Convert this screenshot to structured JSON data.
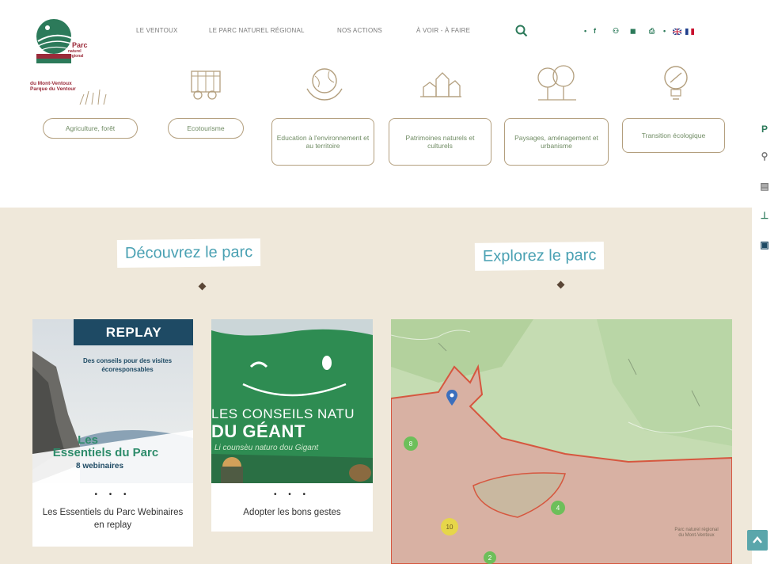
{
  "logo": {
    "brand_big": "Parc",
    "brand_small": "naturel régional",
    "brand_bottom": "du Mont-Ventoux Parque du Ventour",
    "colors": {
      "green": "#2c7a5a",
      "red": "#9b2b3a"
    }
  },
  "nav": {
    "items": [
      {
        "label": "LE VENTOUX"
      },
      {
        "label": "LE PARC NATUREL RÉGIONAL"
      },
      {
        "label": "NOS ACTIONS"
      },
      {
        "label": "À VOIR - À FAIRE"
      }
    ],
    "search_icon": "search-icon"
  },
  "social": {
    "items": [
      {
        "icon": "facebook-icon",
        "glyph": "f"
      },
      {
        "icon": "share-icon",
        "glyph": "⚇"
      },
      {
        "icon": "newsletter-icon",
        "glyph": "◼"
      },
      {
        "icon": "print-icon",
        "glyph": "⎙"
      }
    ],
    "flags": [
      {
        "icon": "flag-uk-icon"
      },
      {
        "icon": "flag-fr-icon"
      }
    ]
  },
  "categories": [
    {
      "label": "Agriculture, forêt",
      "icon": "tractor-icon"
    },
    {
      "label": "Ecotourisme",
      "icon": "tourism-icon"
    },
    {
      "label": "Education à l'environnement et au territoire",
      "icon": "globe-hands-icon"
    },
    {
      "label": "Patrimoines naturels et culturels",
      "icon": "village-icon"
    },
    {
      "label": "Paysages, aménagement et urbanisme",
      "icon": "trees-icon"
    },
    {
      "label": "Transition écologique",
      "icon": "bulb-icon"
    }
  ],
  "sections": {
    "discover_title": "Découvrez le parc",
    "explore_title": "Explorez le parc"
  },
  "cards": [
    {
      "banner": "REPLAY",
      "tagline": "Des conseils pour des visites écoresponsables",
      "image_title_1": "Les",
      "image_title_2": "Essentiels du Parc",
      "image_subtitle": "8 webinaires",
      "dots": "• • •",
      "caption": "Les Essentiels du Parc Webinaires en replay"
    },
    {
      "image_title_1": "LES CONSEILS NATU",
      "image_title_2": "DU GÉANT",
      "image_subtitle": "Li counsèu naturo dou Gigant",
      "dots": "• • •",
      "caption": "Adopter les bons gestes"
    }
  ],
  "map": {
    "markers": [
      {
        "label": "8"
      },
      {
        "label": "4"
      },
      {
        "label": "10"
      },
      {
        "label": "2"
      }
    ],
    "center_label": "Parc naturel régional du Mont-Ventoux"
  },
  "side_toolbar": [
    {
      "icon": "parking-icon",
      "glyph": "P"
    },
    {
      "icon": "hiking-icon",
      "glyph": "⚲"
    },
    {
      "icon": "bus-icon",
      "glyph": "▤"
    },
    {
      "icon": "bench-icon",
      "glyph": "⊥"
    },
    {
      "icon": "map-layer-icon",
      "glyph": "▣"
    }
  ],
  "back_to_top": {
    "icon": "chevron-up-icon"
  }
}
